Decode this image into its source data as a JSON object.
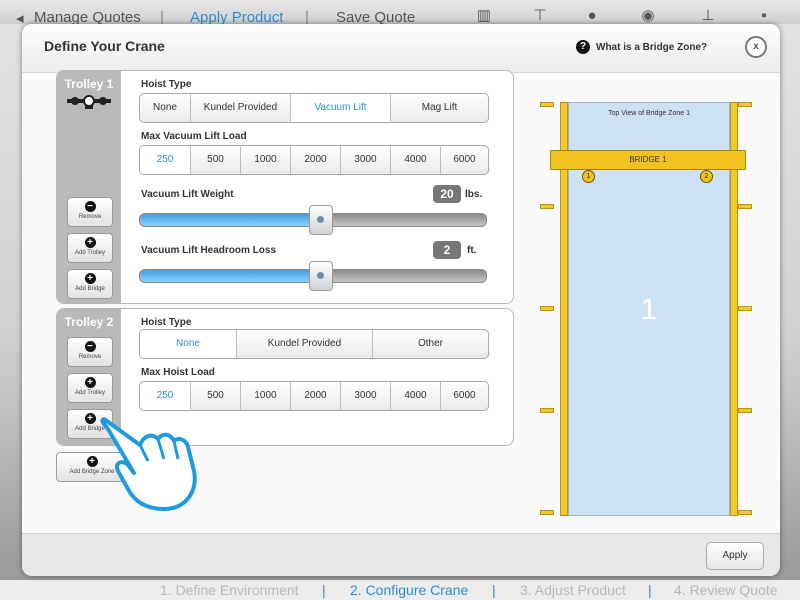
{
  "background": {
    "toolbar": {
      "items": [
        "Manage Quotes",
        "Apply Product",
        "Save Quote"
      ],
      "icons": [
        "building-icon",
        "crane-icon",
        "help-icon",
        "eye-icon",
        "joystick-icon",
        "trash-icon"
      ]
    },
    "steps": [
      "1. Define Environment",
      "2. Configure Crane",
      "3. Adjust Product",
      "4. Review Quote"
    ],
    "step_separator": "|"
  },
  "modal": {
    "title": "Define Your Crane",
    "help_label": "What is a Bridge Zone?",
    "help_icon": "?",
    "close_icon": "x",
    "apply_label": "Apply",
    "add_bridge_zone_label": "Add Bridge Zone"
  },
  "buttons": {
    "remove": "Remove",
    "add_trolley": "Add Trolley",
    "add_bridge": "Add Bridge",
    "minus_icon": "−",
    "plus_icon": "+"
  },
  "trolley1": {
    "name": "Trolley 1",
    "hoist_type_label": "Hoist Type",
    "hoist_types": [
      "None",
      "Kundel Provided",
      "Vacuum Lift",
      "Mag Lift"
    ],
    "hoist_type_selected": "Vacuum Lift",
    "load_label": "Max Vacuum Lift Load",
    "loads": [
      "250",
      "500",
      "1000",
      "2000",
      "3000",
      "4000",
      "6000"
    ],
    "load_selected": "250",
    "weight_label": "Vacuum Lift Weight",
    "weight_value": "20",
    "weight_unit": "lbs.",
    "weight_fraction": 0.52,
    "headroom_label": "Vacuum Lift Headroom Loss",
    "headroom_value": "2",
    "headroom_unit": "ft.",
    "headroom_fraction": 0.52
  },
  "trolley2": {
    "name": "Trolley 2",
    "hoist_type_label": "Hoist Type",
    "hoist_types": [
      "None",
      "Kundel Provided",
      "Other"
    ],
    "hoist_type_selected": "None",
    "load_label": "Max Hoist Load",
    "loads": [
      "250",
      "500",
      "1000",
      "2000",
      "3000",
      "4000",
      "6000"
    ],
    "load_selected": "250"
  },
  "bridge_zone": {
    "title": "Top View of Bridge Zone 1",
    "bridge_label": "BRIDGE 1",
    "zone_number": "1",
    "hooks": [
      "1",
      "2"
    ]
  },
  "colors": {
    "accent": "#2b8fd6",
    "rail": "#f1c82e",
    "zone": "#cde2f4"
  }
}
